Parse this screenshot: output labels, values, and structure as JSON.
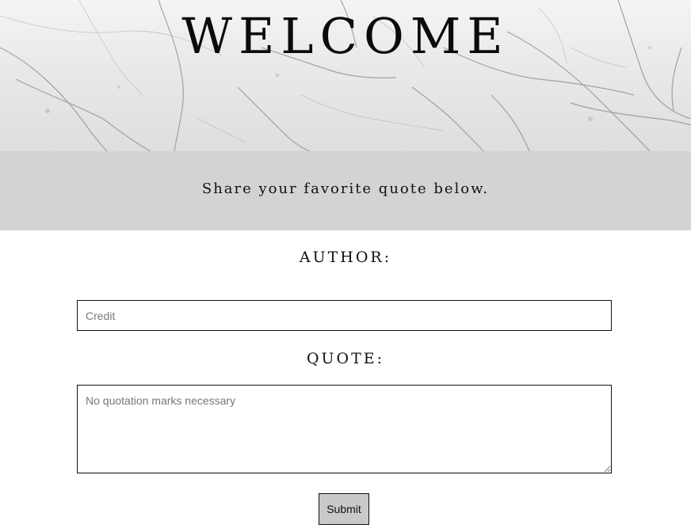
{
  "hero": {
    "title": "WELCOME",
    "background": "marble-texture"
  },
  "banner": {
    "text": "Share your favorite quote below."
  },
  "form": {
    "author_label": "AUTHOR:",
    "author_placeholder": "Credit",
    "author_value": "",
    "quote_label": "QUOTE:",
    "quote_placeholder": "No quotation marks necessary",
    "quote_value": "",
    "submit_label": "Submit"
  },
  "colors": {
    "banner_bg": "#d3d3d3",
    "button_bg": "#c9c9c9",
    "text": "#111111"
  }
}
